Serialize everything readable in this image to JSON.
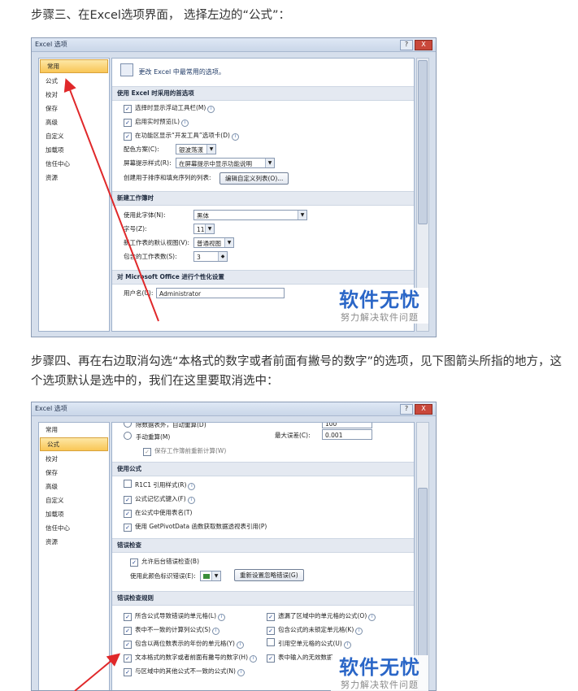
{
  "step3_text": "步骤三、在Excel选项界面， 选择左边的“公式”：",
  "step4_text": "步骤四、再在右边取消勾选“本格式的数字或者前面有撇号的数字”的选项，见下图箭头所指的地方，这个选项默认是选中的，我们在这里要取消选中：",
  "dialog": {
    "title": "Excel 选项",
    "help_btn": "?",
    "close_btn": "X"
  },
  "nav_items": [
    "常用",
    "公式",
    "校对",
    "保存",
    "高级",
    "自定义",
    "加载项",
    "信任中心",
    "资源"
  ],
  "shot1": {
    "header": "更改 Excel 中最常用的选项。",
    "sec1": "使用 Excel 时采用的首选项",
    "opt_mini_toolbar": "选择时显示浮动工具栏(M)",
    "opt_live_preview": "启用实时预览(L)",
    "opt_dev_tab": "在功能区显示“开发工具”选项卡(D)",
    "color_label": "配色方案(C):",
    "color_value": "银波荡漾",
    "tip_label": "屏幕提示样式(R):",
    "tip_value": "在屏幕提示中显示功能说明",
    "custom_list_label": "创建用于排序和填充序列的列表:",
    "custom_list_btn": "编辑自定义列表(O)...",
    "sec2": "新建工作簿时",
    "font_label": "使用此字体(N):",
    "font_value": "黑体",
    "size_label": "字号(Z):",
    "size_value": "11",
    "view_label": "新工作表的默认视图(V):",
    "view_value": "普通视图",
    "sheets_label": "包含的工作表数(S):",
    "sheets_value": "3",
    "sec3": "对 Microsoft Office 进行个性化设置",
    "user_label": "用户名(U):",
    "user_value": "Administrator"
  },
  "shot2": {
    "calc_top": "除数据表外，自动重算(D)",
    "calc_manual": "手动重算(M)",
    "calc_save": "保存工作簿前重新计算(W)",
    "max_change_label": "最大误差(C):",
    "max_change_value": "0.001",
    "top_partial_value": "100",
    "sec_formula": "使用公式",
    "opt_r1c1": "R1C1 引用样式(R)",
    "opt_autocomplete": "公式记忆式键入(F)",
    "opt_table_names": "在公式中使用表名(T)",
    "opt_getpivot": "使用 GetPivotData 函数获取数据透视表引用(P)",
    "sec_error": "错误检查",
    "opt_bg_check": "允许后台错误检查(B)",
    "color_label": "使用此颜色标识错误(E):",
    "reset_btn": "重新设置忽略错误(G)",
    "sec_rules": "错误检查规则",
    "rules_left": [
      "所含公式导致错误的单元格(L)",
      "表中不一致的计算列公式(S)",
      "包含以两位数表示的年份的单元格(Y)",
      "文本格式的数字或者前面有撇号的数字(H)",
      "与区域中的其他公式不一致的公式(N)"
    ],
    "rules_right": [
      "遗漏了区域中的单元格的公式(O)",
      "包含公式的未锁定单元格(K)",
      "引用空单元格的公式(U)",
      "表中输入的无效数据"
    ]
  },
  "watermark": {
    "big": "软件无忧",
    "small": "努力解决软件问题"
  },
  "colors": {
    "arrow": "#e0282a",
    "watermark_blue": "#2a66c7",
    "selected_nav": "#f9c656"
  }
}
